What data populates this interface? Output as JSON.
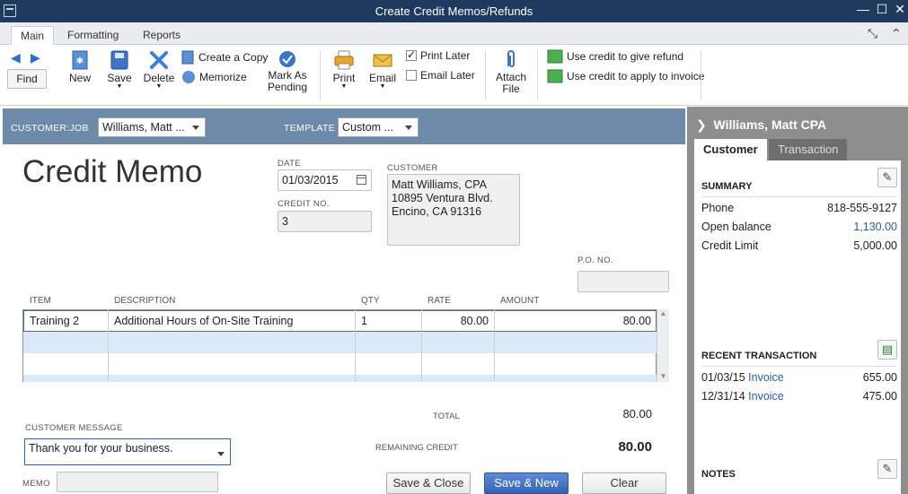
{
  "window": {
    "title": "Create Credit Memos/Refunds",
    "minimize": "—",
    "maximize": "☐",
    "close": "✕"
  },
  "ribbon_tabs": [
    "Main",
    "Formatting",
    "Reports"
  ],
  "ribbon": {
    "find": "Find",
    "new": "New",
    "save": "Save",
    "delete": "Delete",
    "create_copy": "Create a Copy",
    "memorize": "Memorize",
    "mark_as_pending_1": "Mark As",
    "mark_as_pending_2": "Pending",
    "print": "Print",
    "email": "Email",
    "print_later": "Print Later",
    "print_later_checked": true,
    "email_later": "Email Later",
    "email_later_checked": false,
    "attach_file_1": "Attach",
    "attach_file_2": "File",
    "use_credit_refund": "Use credit to give refund",
    "use_credit_invoice": "Use credit to apply to invoice"
  },
  "customer_bar": {
    "customer_job_label": "CUSTOMER:JOB",
    "customer_job_value": "Williams, Matt ...",
    "template_label": "TEMPLATE",
    "template_value": "Custom ..."
  },
  "form": {
    "heading": "Credit Memo",
    "date_label": "DATE",
    "date_value": "01/03/2015",
    "credit_no_label": "CREDIT NO.",
    "credit_no_value": "3",
    "customer_label": "CUSTOMER",
    "customer_address": [
      "Matt Williams, CPA",
      "10895 Ventura Blvd.",
      "Encino, CA 91316"
    ],
    "po_label": "P.O. NO.",
    "po_value": ""
  },
  "grid": {
    "columns": [
      "ITEM",
      "DESCRIPTION",
      "QTY",
      "RATE",
      "AMOUNT"
    ],
    "rows": [
      {
        "item": "Training 2",
        "description": "Additional Hours of On-Site Training",
        "qty": "1",
        "rate": "80.00",
        "amount": "80.00"
      }
    ]
  },
  "totals": {
    "total_label": "TOTAL",
    "total_value": "80.00",
    "remaining_label": "REMAINING CREDIT",
    "remaining_value": "80.00"
  },
  "footer": {
    "customer_message_label": "CUSTOMER MESSAGE",
    "customer_message_value": "Thank you for your business.",
    "memo_label": "MEMO",
    "memo_value": "",
    "save_close": "Save & Close",
    "save_new": "Save & New",
    "clear": "Clear"
  },
  "side_panel": {
    "title": "Williams, Matt CPA",
    "tabs": [
      "Customer",
      "Transaction"
    ],
    "summary_label": "SUMMARY",
    "summary": [
      {
        "label": "Phone",
        "value": "818-555-9127"
      },
      {
        "label": "Open balance",
        "value": "1,130.00"
      },
      {
        "label": "Credit Limit",
        "value": "5,000.00"
      }
    ],
    "recent_label": "RECENT TRANSACTION",
    "recent": [
      {
        "date": "01/03/15",
        "type": "Invoice",
        "amount": "655.00"
      },
      {
        "date": "12/31/14",
        "type": "Invoice",
        "amount": "475.00"
      }
    ],
    "notes_label": "NOTES"
  },
  "colors": {
    "title_bar": "#1f3a5f",
    "customer_bar": "#6d8aa8",
    "primary_button": "#3563b5",
    "link": "#2a5ca8"
  }
}
